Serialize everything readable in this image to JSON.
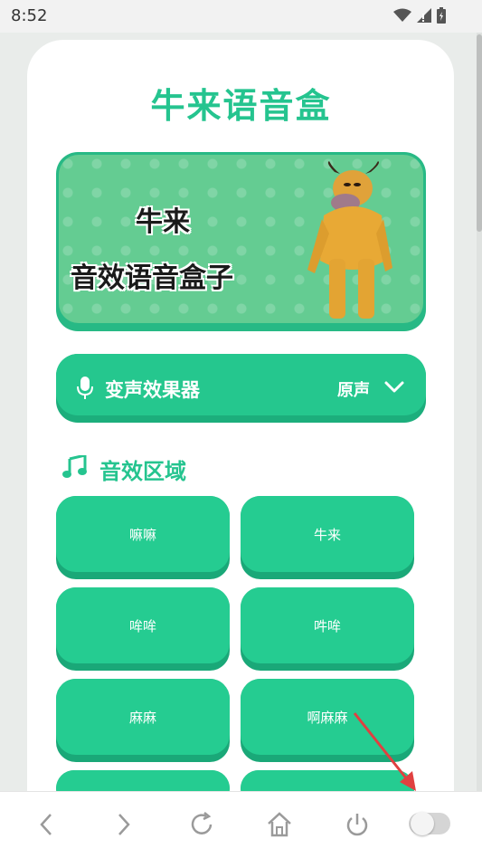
{
  "status_bar": {
    "time": "8:52",
    "icons": [
      "wifi-icon",
      "signal-icon",
      "battery-icon"
    ]
  },
  "app": {
    "title": "牛来语音盒",
    "banner": {
      "line1": "牛来",
      "line2": "音效语音盒子"
    },
    "voice_changer": {
      "label": "变声效果器",
      "selected": "原声"
    },
    "section_title": "音效区域",
    "sounds": [
      {
        "label": "嘛嘛"
      },
      {
        "label": "牛来"
      },
      {
        "label": "哞哞"
      },
      {
        "label": "吽哞"
      },
      {
        "label": "麻麻"
      },
      {
        "label": "啊麻麻"
      }
    ]
  },
  "bottom_nav": {
    "items": [
      "back-icon",
      "forward-icon",
      "refresh-icon",
      "home-icon",
      "power-icon",
      "toggle"
    ]
  },
  "colors": {
    "accent": "#25c48f",
    "button": "#25cc91",
    "button_shadow": "#1aa878",
    "banner": "#64cc92"
  }
}
